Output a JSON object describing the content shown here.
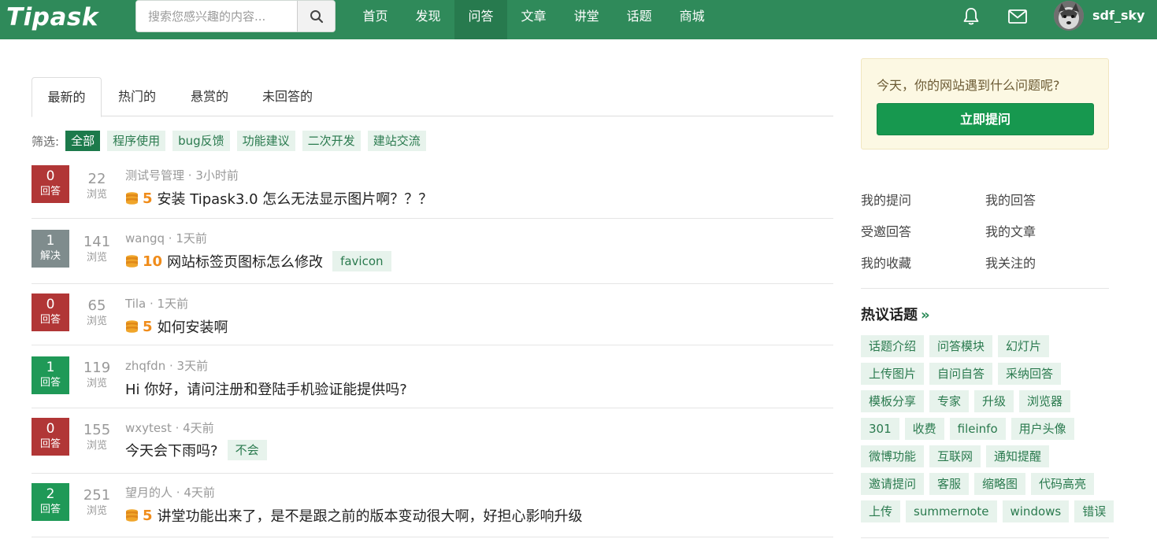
{
  "header": {
    "logo": "Tipask",
    "search_placeholder": "搜索您感兴趣的内容...",
    "nav": [
      "首页",
      "发现",
      "问答",
      "文章",
      "讲堂",
      "话题",
      "商城"
    ],
    "active_nav": "问答",
    "username": "sdf_sky"
  },
  "tabs": [
    "最新的",
    "热门的",
    "悬赏的",
    "未回答的"
  ],
  "filter": {
    "label": "筛选:",
    "tags": [
      "全部",
      "程序使用",
      "bug反馈",
      "功能建议",
      "二次开发",
      "建站交流"
    ]
  },
  "questions": [
    {
      "answers": "0",
      "status_label": "回答",
      "status": "unanswered",
      "views": "22",
      "views_label": "浏览",
      "author": "测试号管理",
      "time": "3小时前",
      "reward": "5",
      "title": "安装 Tipask3.0 怎么无法显示图片啊？？？",
      "tag": ""
    },
    {
      "answers": "1",
      "status_label": "解决",
      "status": "solved",
      "views": "141",
      "views_label": "浏览",
      "author": "wangq",
      "time": "1天前",
      "reward": "10",
      "title": "网站标签页图标怎么修改",
      "tag": "favicon"
    },
    {
      "answers": "0",
      "status_label": "回答",
      "status": "unanswered",
      "views": "65",
      "views_label": "浏览",
      "author": "Tila",
      "time": "1天前",
      "reward": "5",
      "title": "如何安装啊",
      "tag": ""
    },
    {
      "answers": "1",
      "status_label": "回答",
      "status": "answered",
      "views": "119",
      "views_label": "浏览",
      "author": "zhqfdn",
      "time": "3天前",
      "reward": "",
      "title": "Hi 你好，请问注册和登陆手机验证能提供吗?",
      "tag": ""
    },
    {
      "answers": "0",
      "status_label": "回答",
      "status": "unanswered",
      "views": "155",
      "views_label": "浏览",
      "author": "wxytest",
      "time": "4天前",
      "reward": "",
      "title": "今天会下雨吗?",
      "tag": "不会"
    },
    {
      "answers": "2",
      "status_label": "回答",
      "status": "answered",
      "views": "251",
      "views_label": "浏览",
      "author": "望月的人",
      "time": "4天前",
      "reward": "5",
      "title": "讲堂功能出来了，是不是跟之前的版本变动很大啊，好担心影响升级",
      "tag": ""
    }
  ],
  "sidebar": {
    "ask_prompt": "今天，你的网站遇到什么问题呢?",
    "ask_button": "立即提问",
    "my_links": [
      "我的提问",
      "我的回答",
      "受邀回答",
      "我的文章",
      "我的收藏",
      "我关注的"
    ],
    "hot_topics_title": "热议话题",
    "hot_topics_more": "»",
    "topics": [
      [
        "话题介绍",
        "问答模块",
        "幻灯片"
      ],
      [
        "上传图片",
        "自问自答",
        "采纳回答"
      ],
      [
        "模板分享",
        "专家",
        "升级",
        "浏览器"
      ],
      [
        "301",
        "收费",
        "fileinfo",
        "用户头像"
      ],
      [
        "微博功能",
        "互联网",
        "通知提醒"
      ],
      [
        "邀请提问",
        "客服",
        "缩略图",
        "代码高亮"
      ],
      [
        "上传",
        "summernote",
        "windows",
        "错误"
      ]
    ]
  },
  "colors": {
    "brand": "#2f8a5a",
    "unanswered": "#b13636",
    "solved": "#7f8c8d",
    "answered": "#1f9957",
    "reward": "#f08c1a"
  }
}
